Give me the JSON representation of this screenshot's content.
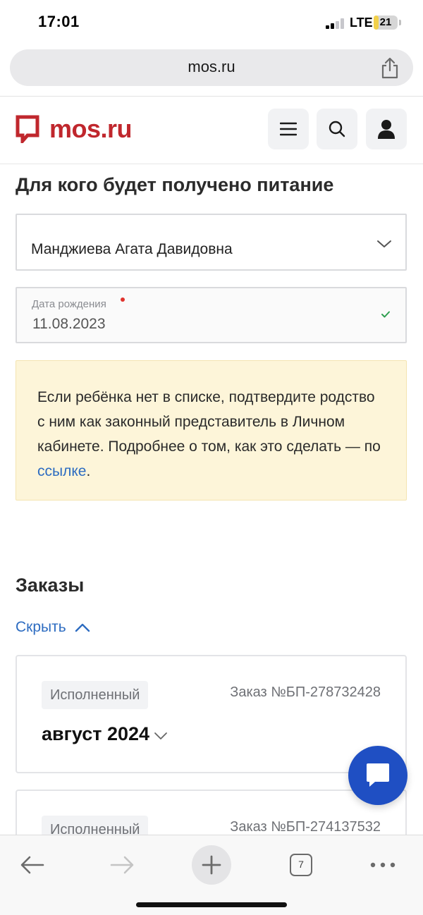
{
  "status_bar": {
    "time": "17:01",
    "network": "LTE",
    "battery": "21",
    "battery_level": 0.21,
    "icons": [
      "signal-icon",
      "battery-icon"
    ]
  },
  "browser": {
    "url": "mos.ru",
    "share_icon": "share-icon",
    "toolbar": {
      "tabs_count": "7",
      "icons": [
        "back-arrow-icon",
        "forward-arrow-icon",
        "plus-icon",
        "tabs-icon",
        "more-icon"
      ]
    }
  },
  "site": {
    "logo_text": "mos.ru",
    "brand_color": "#c0272d",
    "header_icons": [
      "menu-icon",
      "search-icon",
      "user-icon"
    ]
  },
  "form": {
    "section_title": "Для кого будет получено питание",
    "recipient": "Манджиева Агата Давидовна",
    "birth_date_label": "Дата рождения",
    "birth_date_value": "11.08.2023"
  },
  "notice": {
    "text": "Если ребёнка нет в списке, подтвердите родство с ним как законный представитель в Личном кабинете. Подробнее о том, как это сделать — по ",
    "link_text": "ссылке",
    "text_end": ".",
    "background": "#fdf5d9"
  },
  "orders": {
    "title": "Заказы",
    "toggle_label": "Скрыть",
    "items": [
      {
        "status": "Исполненный",
        "number": "Заказ №БП-278732428",
        "month": "август 2024"
      },
      {
        "status": "Исполненный",
        "number": "Заказ №БП-274137532"
      }
    ]
  },
  "accent_color": "#2d6cc1",
  "fab_color": "#1f4fc3"
}
